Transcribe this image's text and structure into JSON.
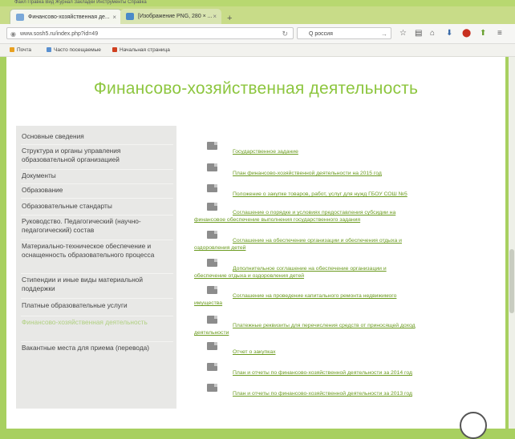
{
  "menubar": {
    "text": "Файл  Правка  Вид  Журнал  Закладки  Инструменты  Справка"
  },
  "tabs": [
    {
      "label": "Финансово-хозяйственная де...",
      "active": true,
      "icon_color": "#7aa8d8"
    },
    {
      "label": "[Изображение PNG, 280 × ...",
      "active": false,
      "icon_color": "#4a8ac8"
    }
  ],
  "newtab_glyph": "+",
  "address": {
    "url": "www.sosh5.ru/index.php?id=49",
    "reload": "↻"
  },
  "search": {
    "query": "Q россия"
  },
  "nav_icons": [
    "star-icon",
    "bookmarks-icon",
    "home-icon",
    "download-icon",
    "addon-icon",
    "shield-icon",
    "menu-icon"
  ],
  "bookmarks": [
    {
      "label": "Почта",
      "color": "#e8a020"
    },
    {
      "label": "Часто посещаемые",
      "color": "#5a90d0"
    },
    {
      "label": "Начальная страница",
      "color": "#d04020"
    }
  ],
  "page": {
    "title": "Финансово-хозяйственная деятельность",
    "sidebar": [
      {
        "label": "Основные сведения",
        "active": false
      },
      {
        "label": "Структура и органы управления образовательной организацией",
        "active": false
      },
      {
        "label": "Документы",
        "active": false
      },
      {
        "label": "Образование",
        "active": false
      },
      {
        "label": "Образовательные стандарты",
        "active": false
      },
      {
        "label": "Руководство. Педагогический (научно-педагогический) состав",
        "active": false
      },
      {
        "label": "Материально-техническое обеспечение и оснащенность образовательного процесса",
        "active": false
      },
      {
        "label": "Стипендии и иные виды материальной поддержки",
        "active": false
      },
      {
        "label": "Платные образовательные услуги",
        "active": false
      },
      {
        "label": "Финансово-хозяйственная деятельность",
        "active": true
      },
      {
        "label": "Вакантные места для приема (перевода)",
        "active": false
      }
    ],
    "documents": [
      {
        "first": "Государственное задание",
        "rest": ""
      },
      {
        "first": "План финансово-хозяйственной деятельности на 2015 год",
        "rest": ""
      },
      {
        "first": "Положение о закупке товаров, работ, услуг для нужд ГБОУ СОШ №5",
        "rest": ""
      },
      {
        "first": "Соглашение о порядке и условиях предоставления субсидии на",
        "rest": "финансовое обеспечение выполнения государственного задания"
      },
      {
        "first": "Соглашение на обеспечение организации и обеспечения отдыха и",
        "rest": "оздоровления детей"
      },
      {
        "first": "Дополнительное соглашение на обеспечение организации и",
        "rest": "обеспечение отдыха и оздоровления детей"
      },
      {
        "first": "Соглашение на проведение капитального ремонта недвижимого",
        "rest": "имущества"
      },
      {
        "first": "Платежные реквизиты для перечисления средств от приносящей доход",
        "rest": "деятельности"
      },
      {
        "first": "Отчет о закупках",
        "rest": ""
      },
      {
        "first": "План и отчеты по финансово-хозяйственной деятельности за 2014 год",
        "rest": ""
      },
      {
        "first": "План и отчеты по финансово-хозяйственной деятельности за 2013 год",
        "rest": ""
      }
    ]
  },
  "colors": {
    "accent": "#8dc63f",
    "link": "#6a9a1e",
    "sidebar_bg": "#e8e8e6"
  }
}
